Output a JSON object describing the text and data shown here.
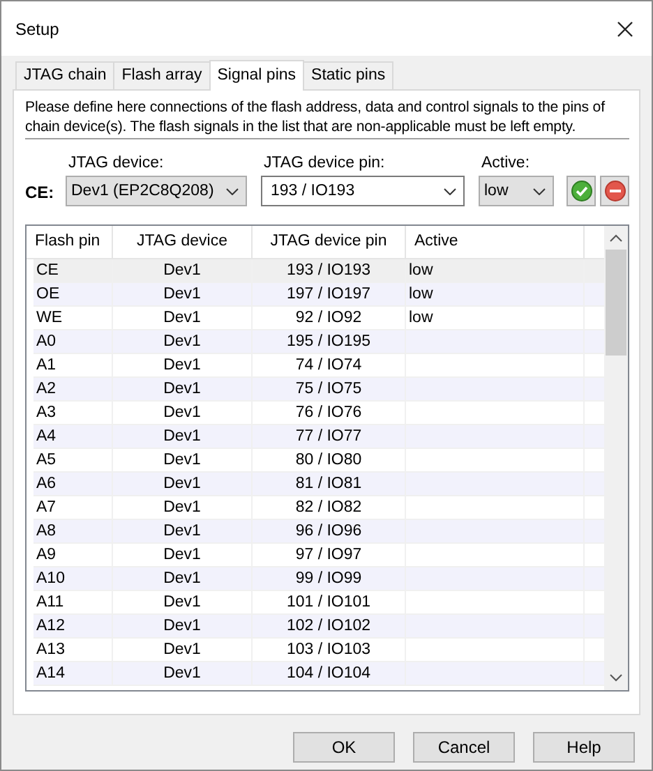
{
  "window": {
    "title": "Setup"
  },
  "tabs": [
    {
      "label": "JTAG chain",
      "selected": false
    },
    {
      "label": "Flash array",
      "selected": false
    },
    {
      "label": "Signal pins",
      "selected": true
    },
    {
      "label": "Static pins",
      "selected": false
    }
  ],
  "description": "Please define here connections of the flash address, data and control signals to the pins of chain device(s). The flash signals in the list that are non-applicable must be left empty.",
  "editor": {
    "signal_label": "CE:",
    "device_label": "JTAG device:",
    "device_value": "Dev1 (EP2C8Q208)",
    "pin_label": "JTAG device pin:",
    "pin_value": "193 / IO193",
    "active_label": "Active:",
    "active_value": "low"
  },
  "table": {
    "columns": [
      "Flash pin",
      "JTAG device",
      "JTAG device pin",
      "Active"
    ],
    "rows": [
      {
        "cells": [
          "CE",
          "Dev1",
          "193 / IO193",
          "low"
        ],
        "selected": true
      },
      {
        "cells": [
          "OE",
          "Dev1",
          "197 / IO197",
          "low"
        ],
        "selected": false
      },
      {
        "cells": [
          "WE",
          "Dev1",
          "92 / IO92",
          "low"
        ],
        "selected": false
      },
      {
        "cells": [
          "A0",
          "Dev1",
          "195 / IO195",
          ""
        ],
        "selected": false
      },
      {
        "cells": [
          "A1",
          "Dev1",
          "74 / IO74",
          ""
        ],
        "selected": false
      },
      {
        "cells": [
          "A2",
          "Dev1",
          "75 / IO75",
          ""
        ],
        "selected": false
      },
      {
        "cells": [
          "A3",
          "Dev1",
          "76 / IO76",
          ""
        ],
        "selected": false
      },
      {
        "cells": [
          "A4",
          "Dev1",
          "77 / IO77",
          ""
        ],
        "selected": false
      },
      {
        "cells": [
          "A5",
          "Dev1",
          "80 / IO80",
          ""
        ],
        "selected": false
      },
      {
        "cells": [
          "A6",
          "Dev1",
          "81 / IO81",
          ""
        ],
        "selected": false
      },
      {
        "cells": [
          "A7",
          "Dev1",
          "82 / IO82",
          ""
        ],
        "selected": false
      },
      {
        "cells": [
          "A8",
          "Dev1",
          "96 / IO96",
          ""
        ],
        "selected": false
      },
      {
        "cells": [
          "A9",
          "Dev1",
          "97 / IO97",
          ""
        ],
        "selected": false
      },
      {
        "cells": [
          "A10",
          "Dev1",
          "99 / IO99",
          ""
        ],
        "selected": false
      },
      {
        "cells": [
          "A11",
          "Dev1",
          "101 / IO101",
          ""
        ],
        "selected": false
      },
      {
        "cells": [
          "A12",
          "Dev1",
          "102 / IO102",
          ""
        ],
        "selected": false
      },
      {
        "cells": [
          "A13",
          "Dev1",
          "103 / IO103",
          ""
        ],
        "selected": false
      },
      {
        "cells": [
          "A14",
          "Dev1",
          "104 / IO104",
          ""
        ],
        "selected": false
      }
    ]
  },
  "buttons": [
    "OK",
    "Cancel",
    "Help"
  ]
}
